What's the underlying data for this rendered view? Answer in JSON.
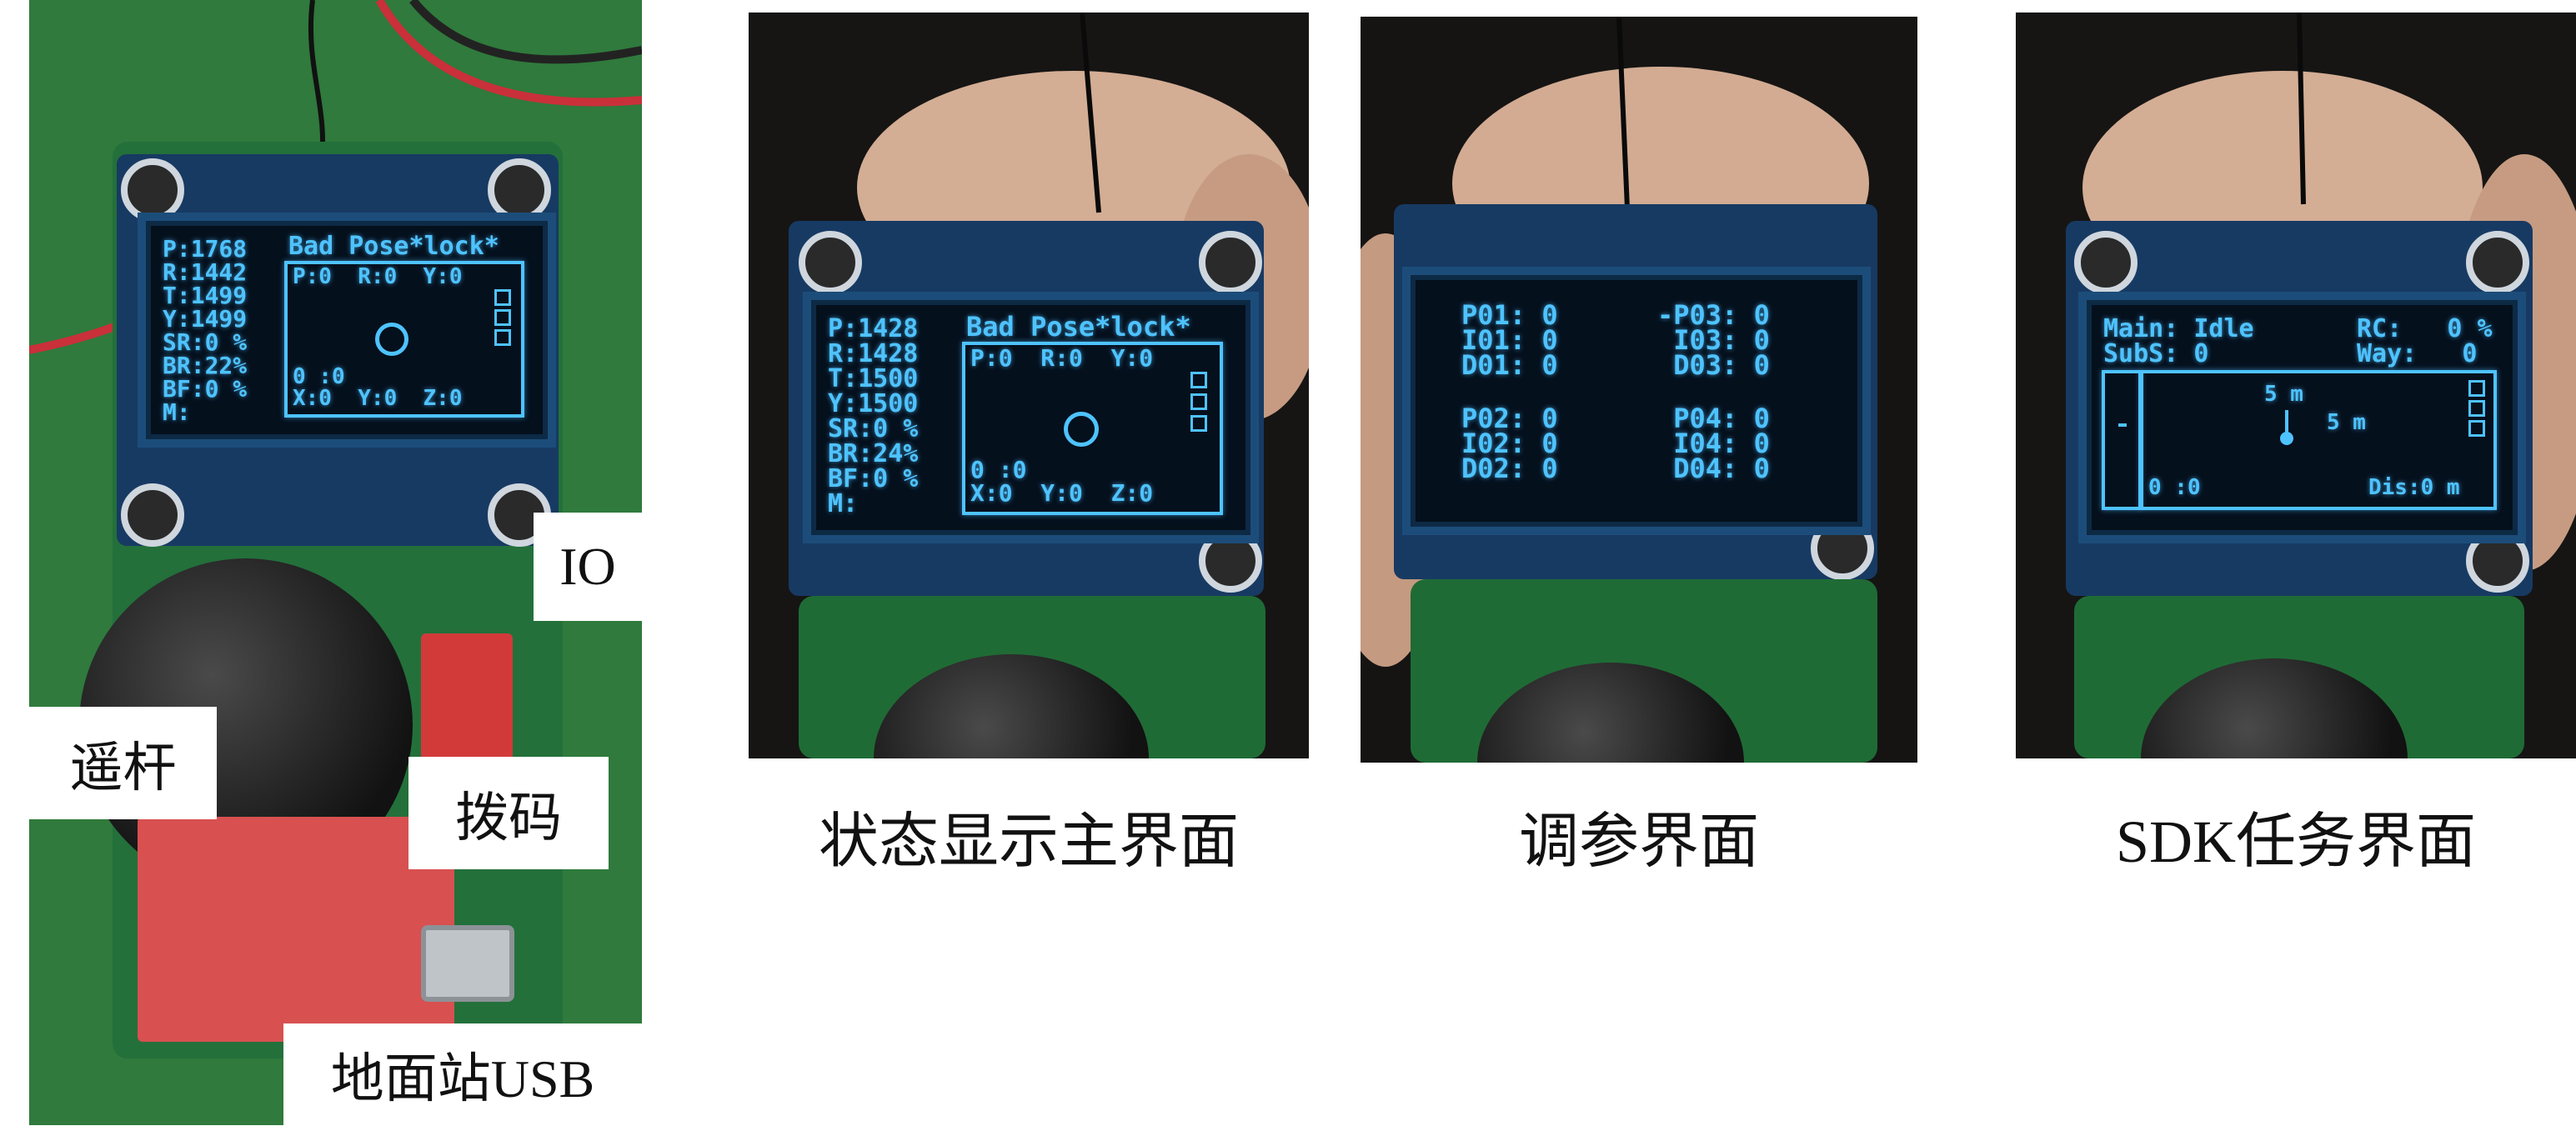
{
  "panel1": {
    "oled": {
      "left": [
        "P:1768",
        "R:1442",
        "T:1499",
        "Y:1499",
        "SR:0 %",
        "BR:22%",
        "BF:0 %",
        "M:"
      ],
      "header": "Bad Pose*lock*",
      "box_top": "P:0  R:0  Y:0",
      "box_mid": "0 :0",
      "box_bottom": "X:0  Y:0  Z:0"
    },
    "labels": {
      "io": "IO",
      "joystick": "遥杆",
      "dip": "拨码",
      "gcs": "地面站USB"
    }
  },
  "panel2": {
    "oled": {
      "left": [
        "P:1428",
        "R:1428",
        "T:1500",
        "Y:1500",
        "SR:0 %",
        "BR:24%",
        "BF:0 %",
        "M:"
      ],
      "header": "Bad Pose*lock*",
      "box_top": "P:0  R:0  Y:0",
      "box_mid": "0 :0",
      "box_bottom": "X:0  Y:0  Z:0"
    },
    "caption": "状态显示主界面"
  },
  "panel3": {
    "oled": {
      "col1": [
        "P01: 0",
        "I01: 0",
        "D01: 0",
        "",
        "P02: 0",
        "I02: 0",
        "D02: 0"
      ],
      "col2": [
        "-P03: 0",
        " I03: 0",
        " D03: 0",
        "",
        " P04: 0",
        " I04: 0",
        " D04: 0"
      ]
    },
    "caption": "调参界面"
  },
  "panel4": {
    "oled": {
      "row1a": "Main: Idle",
      "row1b": "RC:   0 %",
      "row2a": "SubS: 0",
      "row2b": "Way:   0",
      "dist_v": "5 m",
      "dist_h": "5 m",
      "bottom_left": "0 :0",
      "bottom_right": "Dis:0 m"
    },
    "caption": "SDK任务界面"
  },
  "colors": {
    "oled_text": "#4ec3ff",
    "oled_bg": "#05101d",
    "pcb_green": "#1f6b35",
    "shield_blue": "#173a63"
  }
}
